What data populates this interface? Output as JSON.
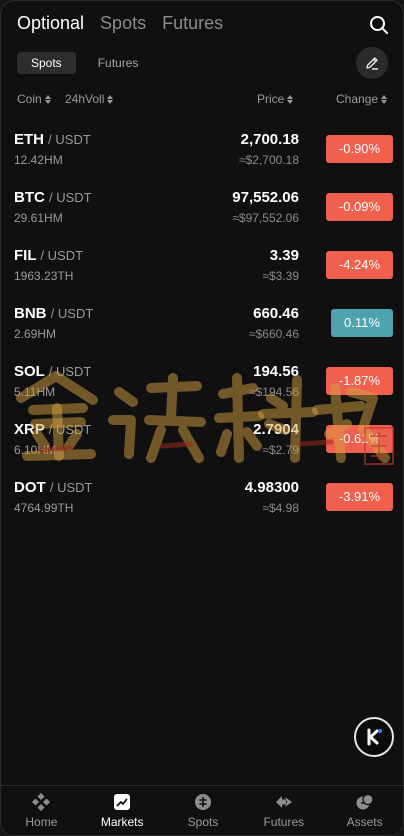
{
  "top_tabs": {
    "optional": "Optional",
    "spots": "Spots",
    "futures": "Futures"
  },
  "sub_tabs": {
    "spots": "Spots",
    "futures": "Futures"
  },
  "headers": {
    "coin": "Coin",
    "volume": "24hVoll",
    "price": "Price",
    "change": "Change"
  },
  "colors": {
    "down": "#f0604f",
    "up": "#4ea3ae",
    "background": "#101010"
  },
  "markets": [
    {
      "base": "ETH",
      "quote": "/ USDT",
      "volume": "12.42HM",
      "price": "2,700.18",
      "fiat": "≈$2,700.18",
      "change": "-0.90%",
      "direction": "down"
    },
    {
      "base": "BTC",
      "quote": "/ USDT",
      "volume": "29.61HM",
      "price": "97,552.06",
      "fiat": "≈$97,552.06",
      "change": "-0.09%",
      "direction": "down"
    },
    {
      "base": "FIL",
      "quote": "/ USDT",
      "volume": "1963.23TH",
      "price": "3.39",
      "fiat": "≈$3.39",
      "change": "-4.24%",
      "direction": "down"
    },
    {
      "base": "BNB",
      "quote": "/ USDT",
      "volume": "2.69HM",
      "price": "660.46",
      "fiat": "≈$660.46",
      "change": "0.11%",
      "direction": "up"
    },
    {
      "base": "SOL",
      "quote": "/ USDT",
      "volume": "5.11HM",
      "price": "194.56",
      "fiat": "≈$194.56",
      "change": "-1.87%",
      "direction": "down"
    },
    {
      "base": "XRP",
      "quote": "/ USDT",
      "volume": "6.10HM",
      "price": "2.7904",
      "fiat": "≈$2.79",
      "change": "-0.61%",
      "direction": "down"
    },
    {
      "base": "DOT",
      "quote": "/ USDT",
      "volume": "4764.99TH",
      "price": "4.98300",
      "fiat": "≈$4.98",
      "change": "-3.91%",
      "direction": "down"
    }
  ],
  "watermark_text": "金该科技",
  "bottom_nav": {
    "home": "Home",
    "markets": "Markets",
    "spots": "Spots",
    "futures": "Futures",
    "assets": "Assets"
  }
}
